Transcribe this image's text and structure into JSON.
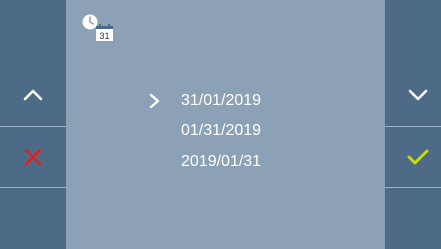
{
  "screen": {
    "title_icon": "date-format-icon",
    "calendar_day": "31"
  },
  "left_panel": {
    "up_button": {
      "icon": "chevron-up-icon"
    },
    "cancel_button": {
      "icon": "close-icon",
      "color": "#e02020"
    }
  },
  "right_panel": {
    "down_button": {
      "icon": "chevron-down-icon"
    },
    "confirm_button": {
      "icon": "check-icon",
      "color": "#c8e000"
    }
  },
  "date_formats": {
    "selected_index": 0,
    "options": [
      "31/01/2019",
      "01/31/2019",
      "2019/01/31"
    ]
  }
}
